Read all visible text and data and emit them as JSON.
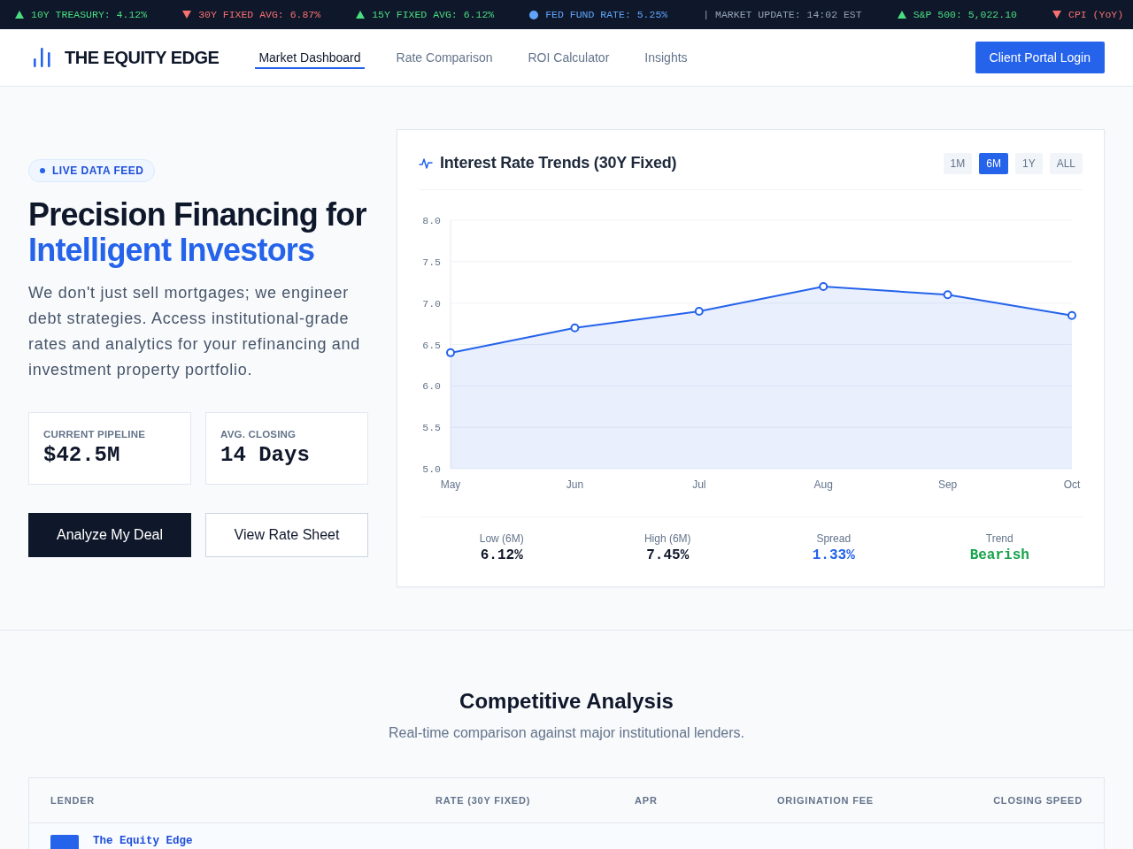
{
  "ticker": [
    {
      "kind": "up",
      "text": "10Y TREASURY: 4.12%"
    },
    {
      "kind": "down",
      "text": "30Y FIXED AVG: 6.87%"
    },
    {
      "kind": "up",
      "text": "15Y FIXED AVG: 6.12%"
    },
    {
      "kind": "info",
      "text": "FED FUND RATE: 5.25%"
    },
    {
      "kind": "plain",
      "text": "| MARKET UPDATE: 14:02 EST"
    },
    {
      "kind": "up",
      "text": "S&P 500: 5,022.10"
    },
    {
      "kind": "down",
      "text": "CPI (YoY)"
    }
  ],
  "nav": {
    "brand": "THE EQUITY EDGE",
    "links": [
      {
        "label": "Market Dashboard",
        "selected": true
      },
      {
        "label": "Rate Comparison",
        "selected": false
      },
      {
        "label": "ROI Calculator",
        "selected": false
      },
      {
        "label": "Insights",
        "selected": false
      }
    ],
    "login_button": "Client Portal Login"
  },
  "hero": {
    "badge": "LIVE DATA FEED",
    "title": "Precision Financing for",
    "title_highlight": "Intelligent Investors",
    "description": "We don't just sell mortgages; we engineer debt strategies. Access institutional-grade rates and analytics for your refinancing and investment property portfolio.",
    "stats": [
      {
        "label": "CURRENT PIPELINE",
        "value": "$42.5M"
      },
      {
        "label": "AVG. CLOSING",
        "value": "14 Days"
      }
    ],
    "buttons": [
      {
        "label": "Analyze My Deal",
        "kind": "primary"
      },
      {
        "label": "View Rate Sheet",
        "kind": "secondary"
      }
    ]
  },
  "rate_chart": {
    "title": "Interest Rate Trends (30Y Fixed)",
    "periods": [
      {
        "label": "1M",
        "selected": false
      },
      {
        "label": "6M",
        "selected": true
      },
      {
        "label": "1Y",
        "selected": false
      },
      {
        "label": "ALL",
        "selected": false
      }
    ],
    "chart_data": {
      "type": "area",
      "categories": [
        "May",
        "Jun",
        "Jul",
        "Aug",
        "Sep",
        "Oct"
      ],
      "series": [
        {
          "color": "#2563eb",
          "values": [
            6.4,
            6.7,
            6.9,
            7.2,
            7.1,
            6.85
          ]
        }
      ],
      "ylim": [
        5,
        8
      ],
      "yticks": [
        {
          "value": 5,
          "label": "5.0"
        },
        {
          "value": 5.5,
          "label": "5.5"
        },
        {
          "value": 6,
          "label": "6.0"
        },
        {
          "value": 6.5,
          "label": "6.5"
        },
        {
          "value": 7,
          "label": "7.0"
        },
        {
          "value": 7.5,
          "label": "7.5"
        },
        {
          "value": 8,
          "label": "8.0"
        }
      ],
      "grid": true
    },
    "summary": [
      {
        "label": "Low (6M)",
        "value": "6.12%",
        "kind": "neutral"
      },
      {
        "label": "High (6M)",
        "value": "7.45%",
        "kind": "neutral"
      },
      {
        "label": "Spread",
        "value": "1.33%",
        "kind": "accent"
      },
      {
        "label": "Trend",
        "value": "Bearish",
        "kind": "positive"
      }
    ]
  },
  "comparison": {
    "title": "Competitive Analysis",
    "subtitle": "Real-time comparison against major institutional lenders.",
    "table": {
      "columns": [
        "LENDER",
        "RATE (30Y FIXED)",
        "APR",
        "ORIGINATION FEE",
        "CLOSING SPEED"
      ],
      "rows": [
        {
          "lender": "The Equity Edge"
        }
      ]
    }
  }
}
